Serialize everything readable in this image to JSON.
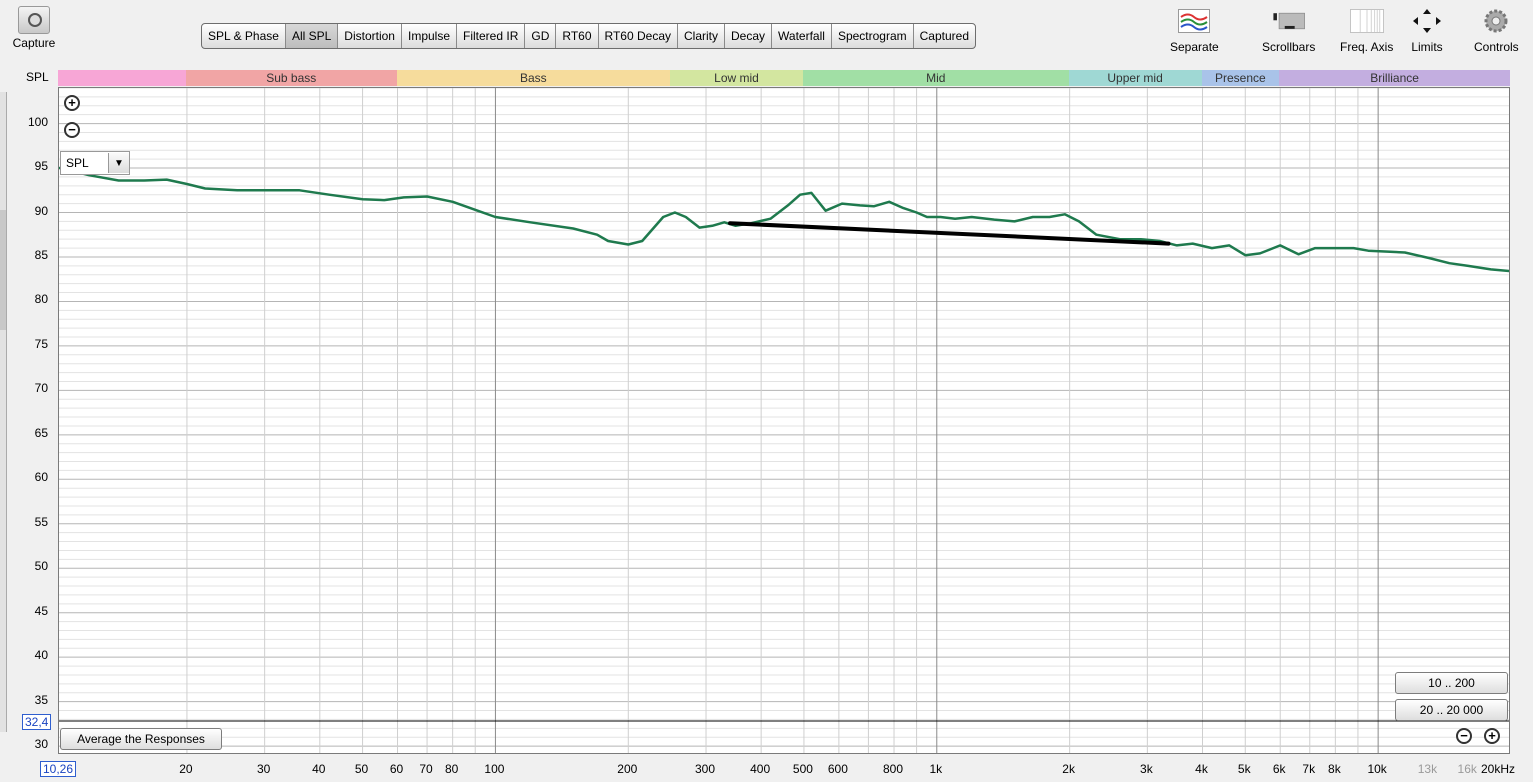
{
  "toolbar": {
    "capture_label": "Capture",
    "tabs": [
      "SPL & Phase",
      "All SPL",
      "Distortion",
      "Impulse",
      "Filtered IR",
      "GD",
      "RT60",
      "RT60 Decay",
      "Clarity",
      "Decay",
      "Waterfall",
      "Spectrogram",
      "Captured"
    ],
    "active_tab": "All SPL"
  },
  "tools": [
    {
      "label": "Separate",
      "icon": "separate-icon"
    },
    {
      "label": "Scrollbars",
      "icon": "scrollbars-icon"
    },
    {
      "label": "Freq. Axis",
      "icon": "freq-axis-icon"
    },
    {
      "label": "Limits",
      "icon": "limits-icon"
    },
    {
      "label": "Controls",
      "icon": "controls-icon"
    }
  ],
  "axis_label": "SPL",
  "bands": [
    {
      "label": "",
      "from": 10,
      "to": 20,
      "color": "#f7a6d6"
    },
    {
      "label": "Sub bass",
      "from": 20,
      "to": 60,
      "color": "#f1a5a5"
    },
    {
      "label": "Bass",
      "from": 60,
      "to": 250,
      "color": "#f6dc9c"
    },
    {
      "label": "Low mid",
      "from": 250,
      "to": 500,
      "color": "#d3e6a0"
    },
    {
      "label": "Mid",
      "from": 500,
      "to": 2000,
      "color": "#a1dfa5"
    },
    {
      "label": "Upper mid",
      "from": 2000,
      "to": 4000,
      "color": "#9fd8d4"
    },
    {
      "label": "Presence",
      "from": 4000,
      "to": 6000,
      "color": "#a9c3e9"
    },
    {
      "label": "Brilliance",
      "from": 6000,
      "to": 20000,
      "color": "#c3aee0"
    }
  ],
  "controls": {
    "spl_dropdown": "SPL",
    "y_min_readout": "32,4",
    "x_min_readout": "10,26",
    "average_button": "Average the Responses",
    "range_buttons": [
      "10 .. 200",
      "20 .. 20 000"
    ]
  },
  "chart_data": {
    "type": "line",
    "ylabel": "SPL",
    "xscale": "log",
    "xlim": [
      10.26,
      20000
    ],
    "ylim": [
      29,
      104
    ],
    "yticks": [
      30,
      35,
      40,
      45,
      50,
      55,
      60,
      65,
      70,
      75,
      80,
      85,
      90,
      95,
      100
    ],
    "xticks": [
      {
        "v": 20,
        "label": "20"
      },
      {
        "v": 30,
        "label": "30"
      },
      {
        "v": 40,
        "label": "40"
      },
      {
        "v": 50,
        "label": "50"
      },
      {
        "v": 60,
        "label": "60"
      },
      {
        "v": 70,
        "label": "70"
      },
      {
        "v": 80,
        "label": "80"
      },
      {
        "v": 100,
        "label": "100"
      },
      {
        "v": 200,
        "label": "200"
      },
      {
        "v": 300,
        "label": "300"
      },
      {
        "v": 400,
        "label": "400"
      },
      {
        "v": 500,
        "label": "500"
      },
      {
        "v": 600,
        "label": "600"
      },
      {
        "v": 800,
        "label": "800"
      },
      {
        "v": 1000,
        "label": "1k"
      },
      {
        "v": 2000,
        "label": "2k"
      },
      {
        "v": 3000,
        "label": "3k"
      },
      {
        "v": 4000,
        "label": "4k"
      },
      {
        "v": 5000,
        "label": "5k"
      },
      {
        "v": 6000,
        "label": "6k"
      },
      {
        "v": 7000,
        "label": "7k"
      },
      {
        "v": 8000,
        "label": "8k"
      },
      {
        "v": 10000,
        "label": "10k"
      },
      {
        "v": 13000,
        "label": "13k",
        "muted": true
      },
      {
        "v": 16000,
        "label": "16k",
        "muted": true
      },
      {
        "v": 20000,
        "label": "20kHz"
      }
    ],
    "series": [
      {
        "color": "#1f7a4e",
        "points": [
          [
            10.3,
            95
          ],
          [
            12,
            94.2
          ],
          [
            14,
            93.6
          ],
          [
            16,
            93.6
          ],
          [
            18,
            93.7
          ],
          [
            20,
            93.2
          ],
          [
            22,
            92.7
          ],
          [
            26,
            92.5
          ],
          [
            30,
            92.5
          ],
          [
            36,
            92.5
          ],
          [
            42,
            92
          ],
          [
            50,
            91.5
          ],
          [
            56,
            91.4
          ],
          [
            62,
            91.7
          ],
          [
            70,
            91.8
          ],
          [
            80,
            91.2
          ],
          [
            90,
            90.3
          ],
          [
            100,
            89.5
          ],
          [
            120,
            88.9
          ],
          [
            150,
            88.2
          ],
          [
            170,
            87.5
          ],
          [
            180,
            86.8
          ],
          [
            200,
            86.4
          ],
          [
            215,
            86.8
          ],
          [
            240,
            89.5
          ],
          [
            255,
            90
          ],
          [
            270,
            89.5
          ],
          [
            290,
            88.3
          ],
          [
            310,
            88.5
          ],
          [
            330,
            88.9
          ],
          [
            350,
            88.5
          ],
          [
            380,
            88.8
          ],
          [
            420,
            89.3
          ],
          [
            460,
            90.8
          ],
          [
            490,
            92
          ],
          [
            520,
            92.2
          ],
          [
            560,
            90.2
          ],
          [
            610,
            91
          ],
          [
            670,
            90.8
          ],
          [
            720,
            90.7
          ],
          [
            780,
            91.2
          ],
          [
            840,
            90.5
          ],
          [
            900,
            90
          ],
          [
            950,
            89.5
          ],
          [
            1020,
            89.5
          ],
          [
            1100,
            89.3
          ],
          [
            1200,
            89.5
          ],
          [
            1350,
            89.2
          ],
          [
            1500,
            89
          ],
          [
            1650,
            89.5
          ],
          [
            1800,
            89.5
          ],
          [
            1950,
            89.8
          ],
          [
            2100,
            89
          ],
          [
            2300,
            87.5
          ],
          [
            2600,
            87
          ],
          [
            2900,
            87
          ],
          [
            3200,
            86.8
          ],
          [
            3500,
            86.3
          ],
          [
            3800,
            86.5
          ],
          [
            4200,
            86
          ],
          [
            4600,
            86.3
          ],
          [
            5000,
            85.2
          ],
          [
            5400,
            85.4
          ],
          [
            6000,
            86.3
          ],
          [
            6600,
            85.3
          ],
          [
            7200,
            86
          ],
          [
            8000,
            86
          ],
          [
            8800,
            86
          ],
          [
            9500,
            85.7
          ],
          [
            10500,
            85.6
          ],
          [
            11500,
            85.5
          ],
          [
            13000,
            84.9
          ],
          [
            14500,
            84.3
          ],
          [
            16000,
            84
          ],
          [
            18000,
            83.6
          ],
          [
            20000,
            83.4
          ]
        ]
      },
      {
        "color": "#000000",
        "points": [
          [
            340,
            88.8
          ],
          [
            3350,
            86.5
          ]
        ]
      }
    ]
  }
}
